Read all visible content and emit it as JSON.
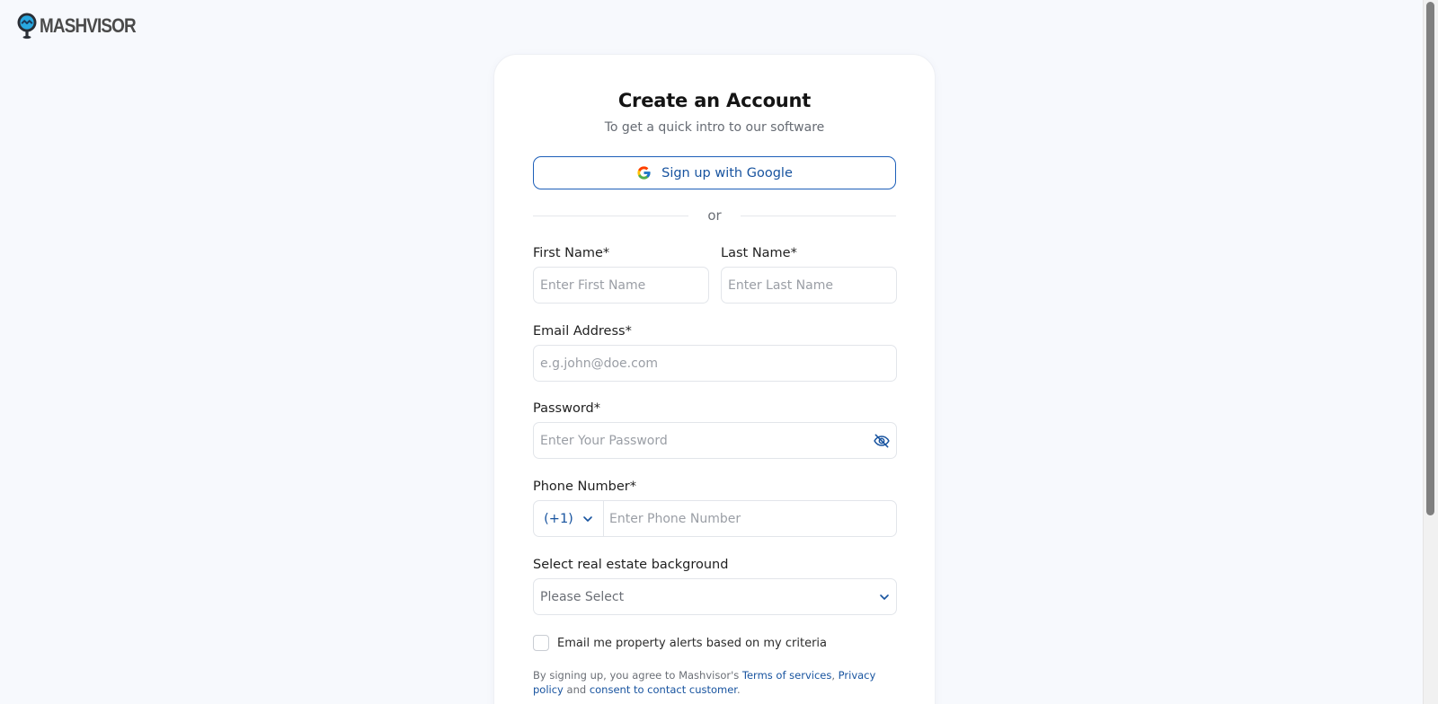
{
  "brand": {
    "name": "MASHVISOR"
  },
  "form": {
    "title": "Create an Account",
    "subtitle": "To get a quick intro to our software",
    "google_button": "Sign up with Google",
    "divider": "or",
    "first_name": {
      "label": "First Name*",
      "placeholder": "Enter First Name",
      "value": ""
    },
    "last_name": {
      "label": "Last Name*",
      "placeholder": "Enter Last Name",
      "value": ""
    },
    "email": {
      "label": "Email Address*",
      "placeholder": "e.g.john@doe.com",
      "value": ""
    },
    "password": {
      "label": "Password*",
      "placeholder": "Enter Your Password",
      "value": ""
    },
    "phone": {
      "label": "Phone Number*",
      "country_code": "(+1)",
      "placeholder": "Enter Phone Number",
      "value": ""
    },
    "background": {
      "label": "Select real estate background",
      "selected": "Please Select"
    },
    "alerts_checkbox": {
      "label": "Email me property alerts based on my criteria",
      "checked": false
    },
    "legal": {
      "prefix": "By signing up, you agree to Mashvisor's",
      "terms": "Terms of services",
      "comma": ",",
      "privacy": "Privacy policy",
      "and": "and",
      "consent": "consent to contact customer",
      "period": "."
    }
  },
  "colors": {
    "accent": "#17539f",
    "background": "#f7f9fd",
    "card": "#ffffff"
  },
  "icons": {
    "logo": "mashvisor-logo-icon",
    "google": "google-icon",
    "password_toggle": "eye-off-icon",
    "dropdown": "chevron-down-icon"
  }
}
